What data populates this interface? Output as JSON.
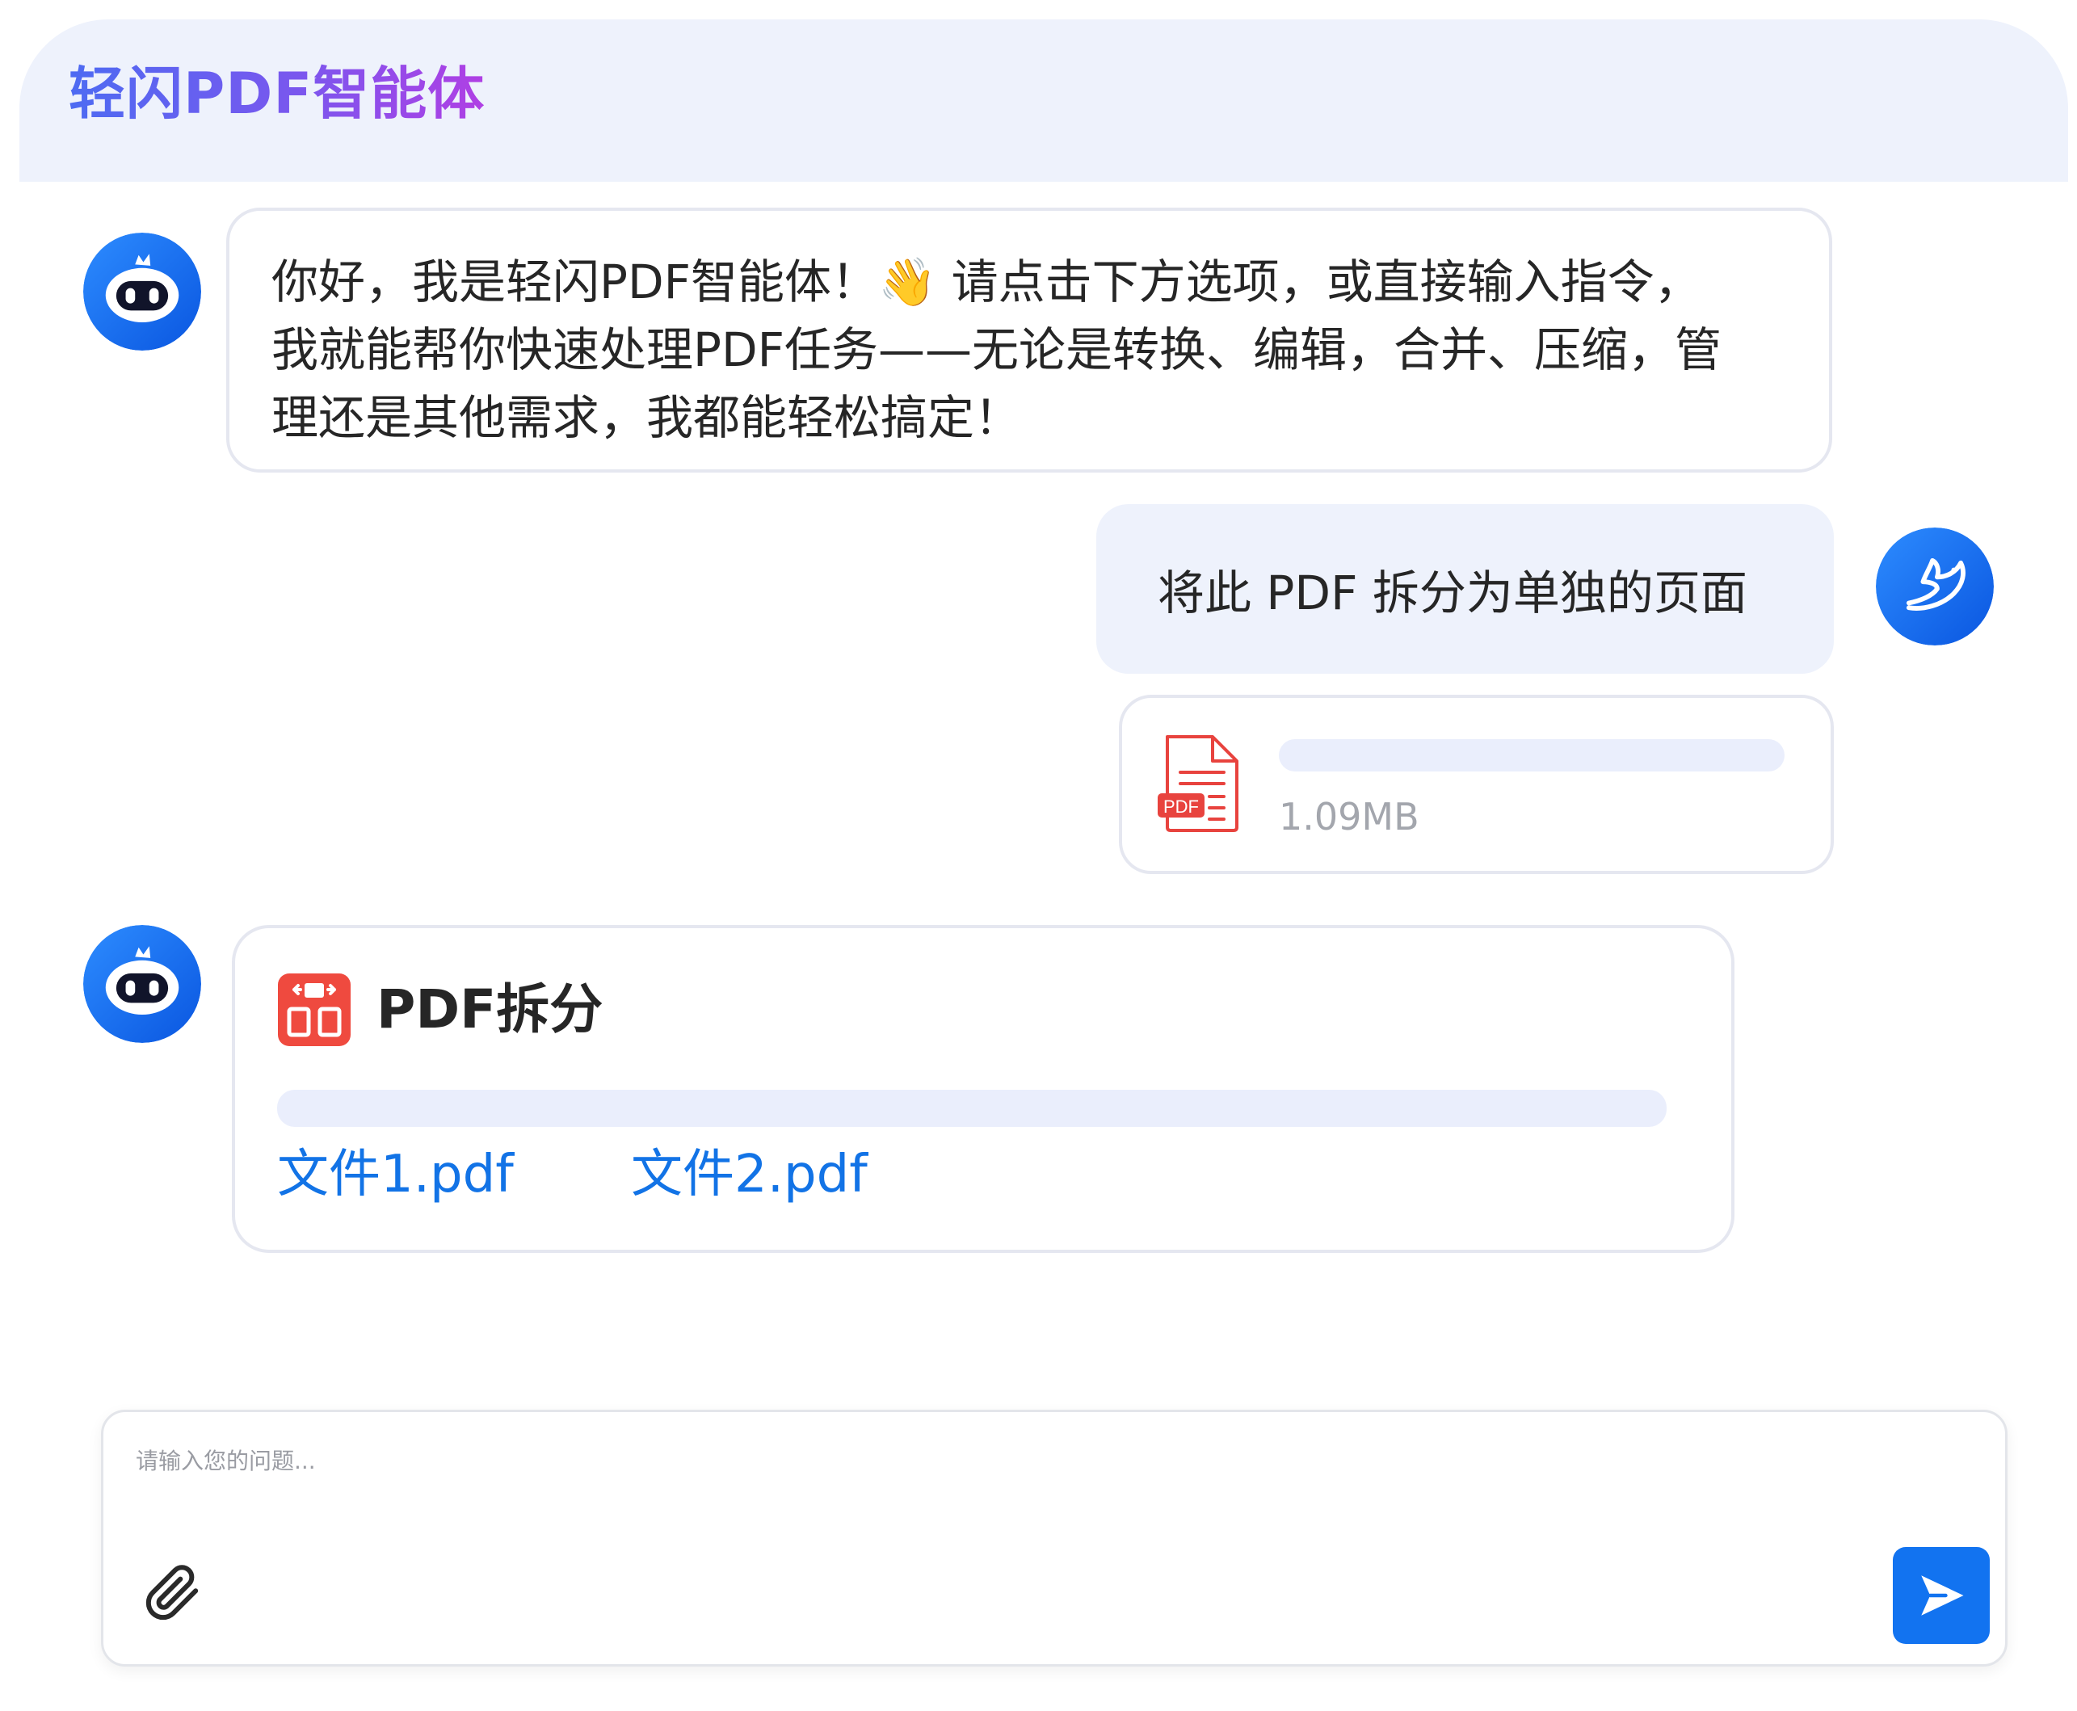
{
  "header": {
    "title": "轻闪PDF智能体"
  },
  "messages": {
    "greeting_lines": [
      "你好，我是轻闪PDF智能体！👋 请点击下方选项，或直接输入指令，",
      "我就能帮你快速处理PDF任务——无论是转换、编辑，合并、压缩，管",
      "理还是其他需求，我都能轻松搞定！"
    ],
    "user_prompt": "将此 PDF 拆分为单独的页面",
    "attached_file": {
      "icon": "pdf-file-icon",
      "badge": "PDF",
      "size": "1.09MB"
    },
    "result": {
      "icon": "pdf-split-icon",
      "title": "PDF拆分",
      "files": [
        "文件1.pdf",
        "文件2.pdf"
      ]
    }
  },
  "composer": {
    "placeholder": "请输入您的问题...",
    "attach_icon": "paperclip-icon",
    "send_icon": "send-icon"
  },
  "colors": {
    "accent_blue": "#1273F0",
    "link_blue": "#1273E6",
    "header_bg": "#EEF2FC",
    "pdf_red": "#E8433E",
    "title_gradient_start": "#4D6BF2",
    "title_gradient_end": "#B03FE4"
  }
}
